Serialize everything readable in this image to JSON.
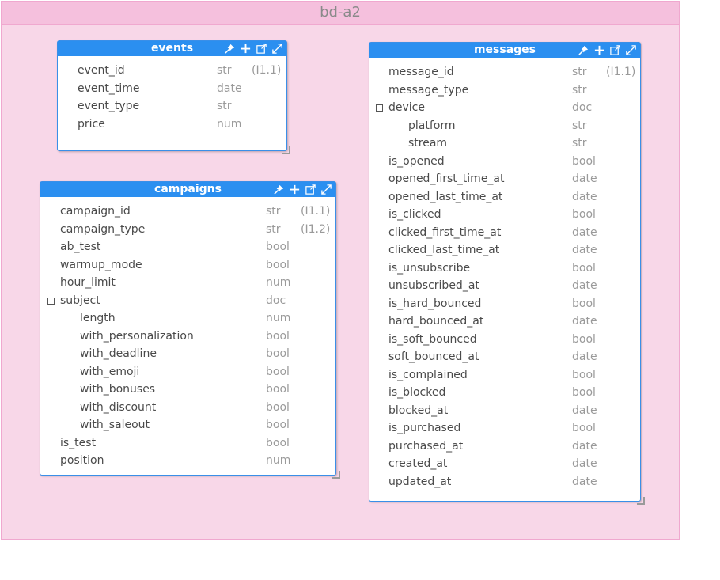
{
  "container": {
    "title": "bd-a2"
  },
  "tables": {
    "events": {
      "title": "events",
      "fields": [
        {
          "name": "event_id",
          "type": "str",
          "index": "(I1.1)"
        },
        {
          "name": "event_time",
          "type": "date",
          "index": ""
        },
        {
          "name": "event_type",
          "type": "str",
          "index": ""
        },
        {
          "name": "price",
          "type": "num",
          "index": ""
        }
      ]
    },
    "campaigns": {
      "title": "campaigns",
      "fields": [
        {
          "name": "campaign_id",
          "type": "str",
          "index": "(I1.1)"
        },
        {
          "name": "campaign_type",
          "type": "str",
          "index": "(I1.2)"
        },
        {
          "name": "ab_test",
          "type": "bool",
          "index": ""
        },
        {
          "name": "warmup_mode",
          "type": "bool",
          "index": ""
        },
        {
          "name": "hour_limit",
          "type": "num",
          "index": ""
        },
        {
          "name": "subject",
          "type": "doc",
          "index": ""
        },
        {
          "name": "length",
          "type": "num",
          "index": ""
        },
        {
          "name": "with_personalization",
          "type": "bool",
          "index": ""
        },
        {
          "name": "with_deadline",
          "type": "bool",
          "index": ""
        },
        {
          "name": "with_emoji",
          "type": "bool",
          "index": ""
        },
        {
          "name": "with_bonuses",
          "type": "bool",
          "index": ""
        },
        {
          "name": "with_discount",
          "type": "bool",
          "index": ""
        },
        {
          "name": "with_saleout",
          "type": "bool",
          "index": ""
        },
        {
          "name": "is_test",
          "type": "bool",
          "index": ""
        },
        {
          "name": "position",
          "type": "num",
          "index": ""
        }
      ]
    },
    "messages": {
      "title": "messages",
      "fields": [
        {
          "name": "message_id",
          "type": "str",
          "index": "(I1.1)"
        },
        {
          "name": "message_type",
          "type": "str",
          "index": ""
        },
        {
          "name": "device",
          "type": "doc",
          "index": ""
        },
        {
          "name": "platform",
          "type": "str",
          "index": ""
        },
        {
          "name": "stream",
          "type": "str",
          "index": ""
        },
        {
          "name": "is_opened",
          "type": "bool",
          "index": ""
        },
        {
          "name": "opened_first_time_at",
          "type": "date",
          "index": ""
        },
        {
          "name": "opened_last_time_at",
          "type": "date",
          "index": ""
        },
        {
          "name": "is_clicked",
          "type": "bool",
          "index": ""
        },
        {
          "name": "clicked_first_time_at",
          "type": "date",
          "index": ""
        },
        {
          "name": "clicked_last_time_at",
          "type": "date",
          "index": ""
        },
        {
          "name": "is_unsubscribe",
          "type": "bool",
          "index": ""
        },
        {
          "name": "unsubscribed_at",
          "type": "date",
          "index": ""
        },
        {
          "name": "is_hard_bounced",
          "type": "bool",
          "index": ""
        },
        {
          "name": "hard_bounced_at",
          "type": "date",
          "index": ""
        },
        {
          "name": "is_soft_bounced",
          "type": "bool",
          "index": ""
        },
        {
          "name": "soft_bounced_at",
          "type": "date",
          "index": ""
        },
        {
          "name": "is_complained",
          "type": "bool",
          "index": ""
        },
        {
          "name": "is_blocked",
          "type": "bool",
          "index": ""
        },
        {
          "name": "blocked_at",
          "type": "date",
          "index": ""
        },
        {
          "name": "is_purchased",
          "type": "bool",
          "index": ""
        },
        {
          "name": "purchased_at",
          "type": "date",
          "index": ""
        },
        {
          "name": "created_at",
          "type": "date",
          "index": ""
        },
        {
          "name": "updated_at",
          "type": "date",
          "index": ""
        }
      ]
    }
  },
  "header_icons": [
    "pin-icon",
    "plus-icon",
    "open-external-icon",
    "expand-icon"
  ],
  "colors": {
    "header": "#2b8ff0",
    "container_bg": "#f8d7e8",
    "container_border": "#f0a8cf"
  }
}
